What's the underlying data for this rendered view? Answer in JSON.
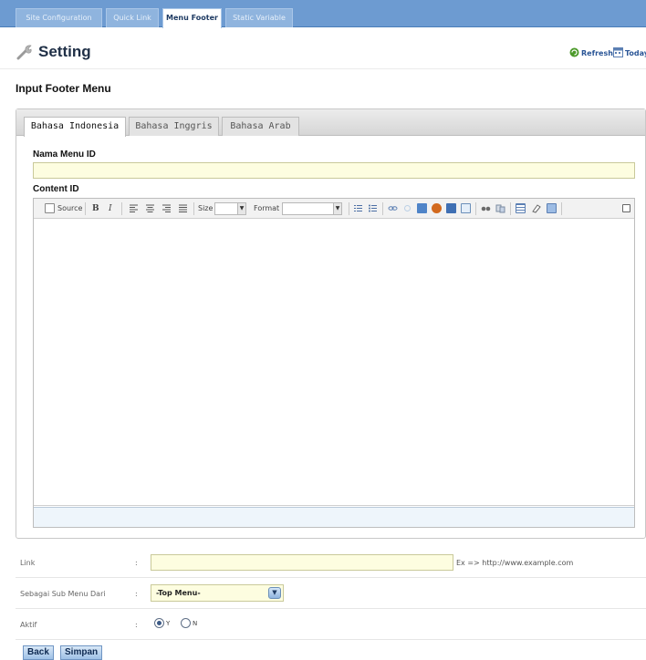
{
  "top_tabs": [
    "Site Configuration",
    "Quick Link",
    "Menu Footer",
    "Static Variable"
  ],
  "header": {
    "title": "Setting",
    "refresh_label": "Refresh",
    "today_label": "Today"
  },
  "section_title": "Input Footer Menu",
  "lang_tabs": [
    "Bahasa Indonesia",
    "Bahasa Inggris",
    "Bahasa Arab"
  ],
  "form": {
    "nama_menu_label": "Nama Menu ID",
    "nama_menu_value": "",
    "content_label": "Content ID"
  },
  "editor": {
    "source_label": "Source",
    "bold_label": "B",
    "italic_label": "I",
    "size_label": "Size",
    "format_label": "Format"
  },
  "link_row": {
    "label": "Link",
    "colon": ":",
    "value": "",
    "hint": "Ex => http://www.example.com"
  },
  "submenu_row": {
    "label": "Sebagai Sub Menu Dari",
    "colon": ":",
    "selected": "-Top Menu-"
  },
  "aktif_row": {
    "label": "Aktif",
    "colon": ":",
    "option_y": "Y",
    "option_n": "N",
    "selected": "Y"
  },
  "buttons": {
    "back": "Back",
    "simpan": "Simpan"
  }
}
